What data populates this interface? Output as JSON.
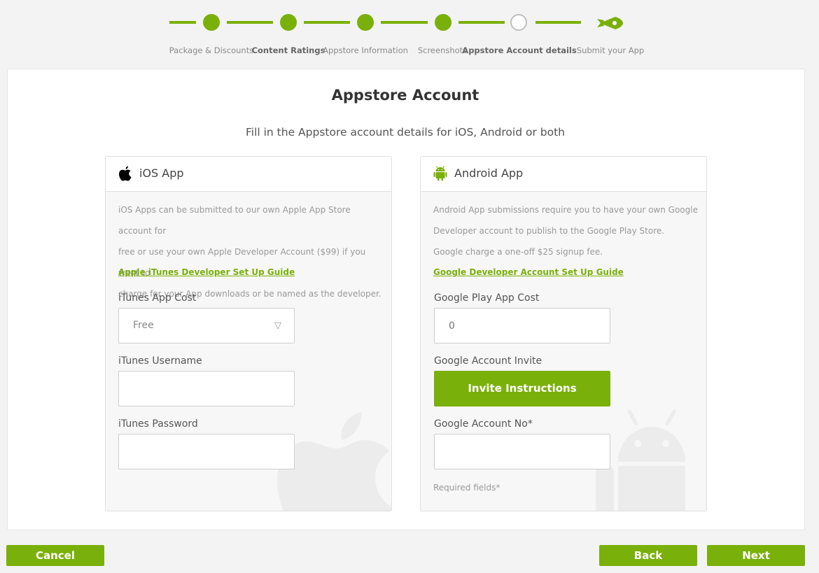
{
  "stepper": {
    "steps": [
      {
        "label": "Package & Discounts",
        "state": "done"
      },
      {
        "label": "Content Ratings",
        "state": "done"
      },
      {
        "label": "Appstore Information",
        "state": "done"
      },
      {
        "label": "Screenshots",
        "state": "done"
      },
      {
        "label": "Appstore Account details",
        "state": "current"
      },
      {
        "label": "Submit your App",
        "state": "upcoming",
        "icon": "rocket-icon"
      }
    ]
  },
  "page": {
    "title": "Appstore Account",
    "subtitle": "Fill in the Appstore account details for iOS, Android or both"
  },
  "ios": {
    "title": "iOS App",
    "icon": "apple-icon",
    "description_lines": [
      "iOS Apps can be submitted to our own Apple App Store account for",
      "free or use your own Apple Developer Account ($99) if you want to",
      "charge for your App downloads or be named as the developer."
    ],
    "guide_link": "Apple iTunes Developer Set Up Guide",
    "cost_label": "iTunes App Cost",
    "cost_value": "Free",
    "username_label": "iTunes Username",
    "username_value": "",
    "password_label": "iTunes Password",
    "password_value": ""
  },
  "android": {
    "title": "Android App",
    "icon": "android-icon",
    "description_lines": [
      "Android App submissions require you to have your own Google",
      "Developer account to publish to the Google Play Store.",
      "Google charge a one-off $25 signup fee."
    ],
    "guide_link": "Google Developer Account Set Up Guide",
    "cost_label": "Google Play App Cost",
    "cost_placeholder": "0",
    "invite_label": "Google Account Invite",
    "invite_button": "Invite Instructions",
    "account_label": "Google Account No*",
    "account_value": "",
    "required_note": "Required fields*"
  },
  "footer": {
    "cancel": "Cancel",
    "back": "Back",
    "next": "Next"
  },
  "colors": {
    "accent": "#7ab00a",
    "background": "#f3f3f3",
    "panel": "#f7f7f7"
  }
}
